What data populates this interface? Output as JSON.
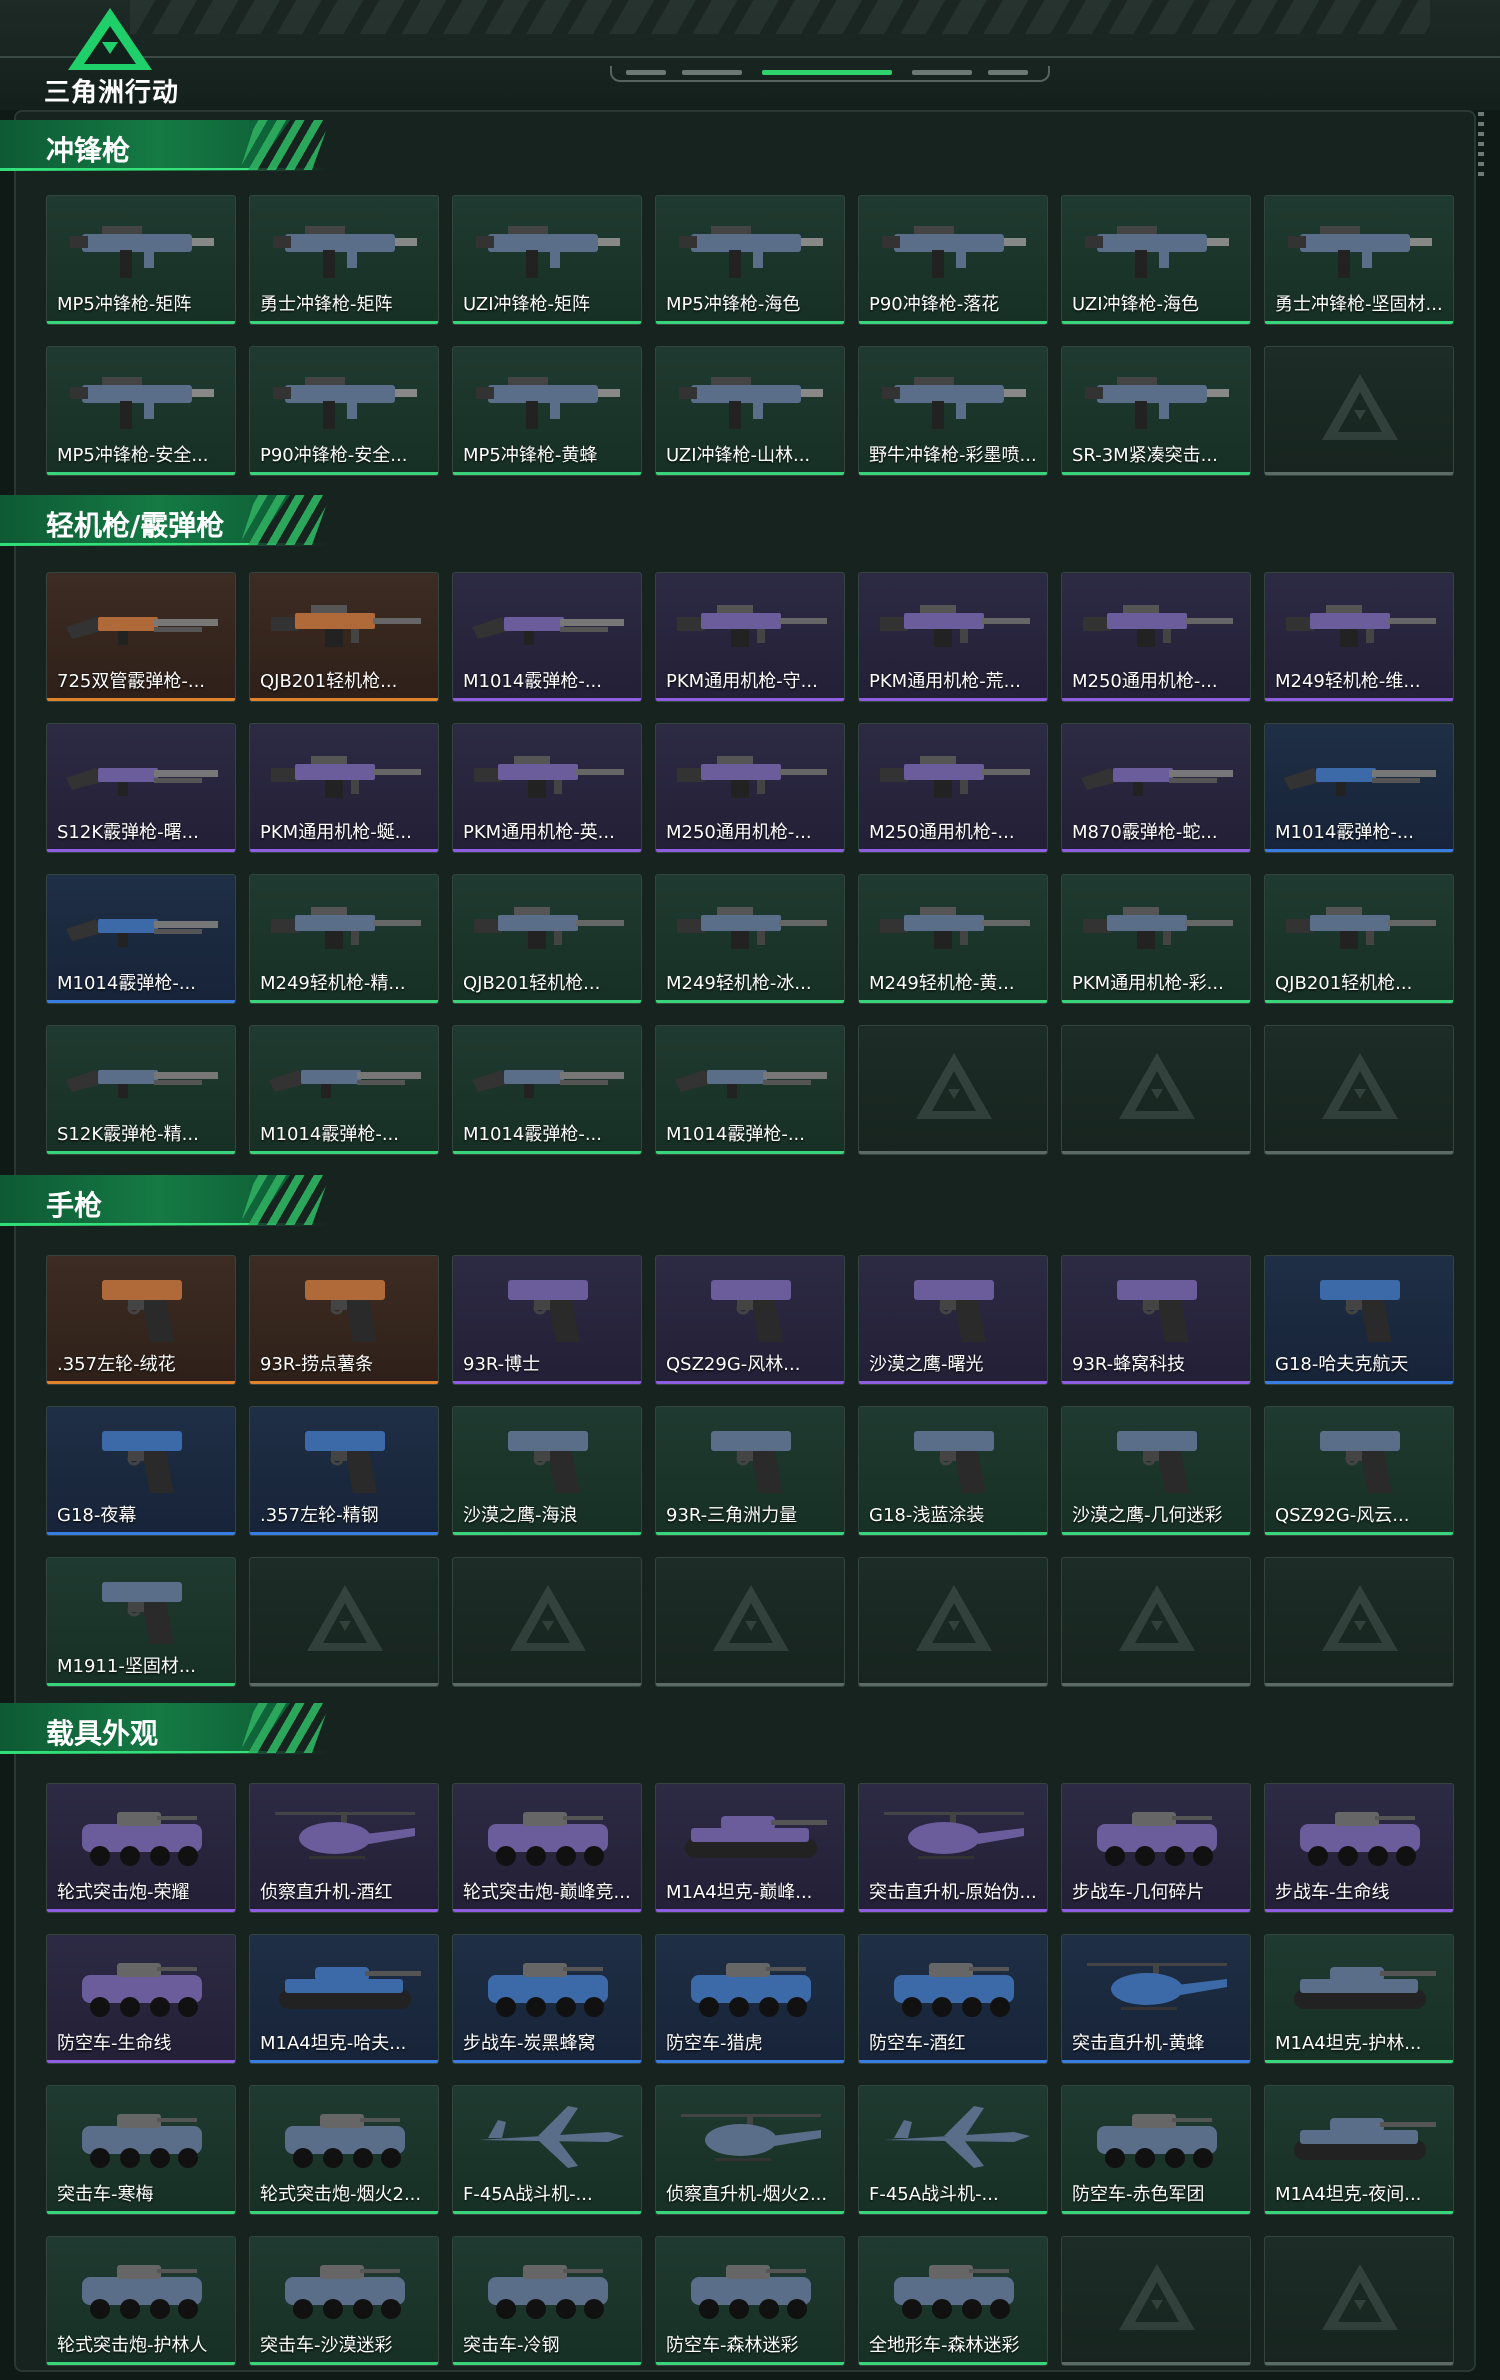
{
  "header": {
    "brand": "三角洲行动",
    "colors": {
      "accent": "#2fd36b",
      "panel": "#16231f"
    }
  },
  "sections": [
    {
      "title": "冲锋枪",
      "items": [
        {
          "label": "MP5冲锋枪-矩阵",
          "rarity": "green",
          "icon": "smg-icon"
        },
        {
          "label": "勇士冲锋枪-矩阵",
          "rarity": "green",
          "icon": "smg-icon"
        },
        {
          "label": "UZI冲锋枪-矩阵",
          "rarity": "green",
          "icon": "smg-icon"
        },
        {
          "label": "MP5冲锋枪-海色",
          "rarity": "green",
          "icon": "smg-icon"
        },
        {
          "label": "P90冲锋枪-落花",
          "rarity": "green",
          "icon": "smg-icon"
        },
        {
          "label": "UZI冲锋枪-海色",
          "rarity": "green",
          "icon": "smg-icon"
        },
        {
          "label": "勇士冲锋枪-坚固材...",
          "rarity": "green",
          "icon": "smg-icon"
        },
        {
          "label": "MP5冲锋枪-安全...",
          "rarity": "green",
          "icon": "smg-icon"
        },
        {
          "label": "P90冲锋枪-安全...",
          "rarity": "green",
          "icon": "smg-icon"
        },
        {
          "label": "MP5冲锋枪-黄蜂",
          "rarity": "green",
          "icon": "smg-icon"
        },
        {
          "label": "UZI冲锋枪-山林...",
          "rarity": "green",
          "icon": "smg-icon"
        },
        {
          "label": "野牛冲锋枪-彩墨喷...",
          "rarity": "green",
          "icon": "smg-icon"
        },
        {
          "label": "SR-3M紧凑突击...",
          "rarity": "green",
          "icon": "smg-icon"
        },
        {
          "label": "",
          "rarity": "empty",
          "icon": ""
        }
      ]
    },
    {
      "title": "轻机枪/霰弹枪",
      "items": [
        {
          "label": "725双管霰弹枪-...",
          "rarity": "orange",
          "icon": "shotgun-icon"
        },
        {
          "label": "QJB201轻机枪...",
          "rarity": "orange",
          "icon": "lmg-icon"
        },
        {
          "label": "M1014霰弹枪-...",
          "rarity": "purple",
          "icon": "shotgun-icon"
        },
        {
          "label": "PKM通用机枪-守...",
          "rarity": "purple",
          "icon": "lmg-icon"
        },
        {
          "label": "PKM通用机枪-荒...",
          "rarity": "purple",
          "icon": "lmg-icon"
        },
        {
          "label": "M250通用机枪-...",
          "rarity": "purple",
          "icon": "lmg-icon"
        },
        {
          "label": "M249轻机枪-维...",
          "rarity": "purple",
          "icon": "lmg-icon"
        },
        {
          "label": "S12K霰弹枪-曙...",
          "rarity": "purple",
          "icon": "shotgun-icon"
        },
        {
          "label": "PKM通用机枪-蜒...",
          "rarity": "purple",
          "icon": "lmg-icon"
        },
        {
          "label": "PKM通用机枪-英...",
          "rarity": "purple",
          "icon": "lmg-icon"
        },
        {
          "label": "M250通用机枪-...",
          "rarity": "purple",
          "icon": "lmg-icon"
        },
        {
          "label": "M250通用机枪-...",
          "rarity": "purple",
          "icon": "lmg-icon"
        },
        {
          "label": "M870霰弹枪-蛇...",
          "rarity": "purple",
          "icon": "shotgun-icon"
        },
        {
          "label": "M1014霰弹枪-...",
          "rarity": "blue",
          "icon": "shotgun-icon"
        },
        {
          "label": "M1014霰弹枪-...",
          "rarity": "blue",
          "icon": "shotgun-icon"
        },
        {
          "label": "M249轻机枪-精...",
          "rarity": "green",
          "icon": "lmg-icon"
        },
        {
          "label": "QJB201轻机枪...",
          "rarity": "green",
          "icon": "lmg-icon"
        },
        {
          "label": "M249轻机枪-冰...",
          "rarity": "green",
          "icon": "lmg-icon"
        },
        {
          "label": "M249轻机枪-黄...",
          "rarity": "green",
          "icon": "lmg-icon"
        },
        {
          "label": "PKM通用机枪-彩...",
          "rarity": "green",
          "icon": "lmg-icon"
        },
        {
          "label": "QJB201轻机枪...",
          "rarity": "green",
          "icon": "lmg-icon"
        },
        {
          "label": "S12K霰弹枪-精...",
          "rarity": "green",
          "icon": "shotgun-icon"
        },
        {
          "label": "M1014霰弹枪-...",
          "rarity": "green",
          "icon": "shotgun-icon"
        },
        {
          "label": "M1014霰弹枪-...",
          "rarity": "green",
          "icon": "shotgun-icon"
        },
        {
          "label": "M1014霰弹枪-...",
          "rarity": "green",
          "icon": "shotgun-icon"
        },
        {
          "label": "",
          "rarity": "empty",
          "icon": ""
        },
        {
          "label": "",
          "rarity": "empty",
          "icon": ""
        },
        {
          "label": "",
          "rarity": "empty",
          "icon": ""
        }
      ]
    },
    {
      "title": "手枪",
      "items": [
        {
          "label": ".357左轮-绒花",
          "rarity": "orange",
          "icon": "pistol-icon"
        },
        {
          "label": "93R-捞点薯条",
          "rarity": "orange",
          "icon": "pistol-icon"
        },
        {
          "label": "93R-博士",
          "rarity": "purple",
          "icon": "pistol-icon"
        },
        {
          "label": "QSZ29G-风林...",
          "rarity": "purple",
          "icon": "pistol-icon"
        },
        {
          "label": "沙漠之鹰-曙光",
          "rarity": "purple",
          "icon": "pistol-icon"
        },
        {
          "label": "93R-蜂窝科技",
          "rarity": "purple",
          "icon": "pistol-icon"
        },
        {
          "label": "G18-哈夫克航天",
          "rarity": "blue",
          "icon": "pistol-icon"
        },
        {
          "label": "G18-夜幕",
          "rarity": "blue",
          "icon": "pistol-icon"
        },
        {
          "label": ".357左轮-精钢",
          "rarity": "blue",
          "icon": "pistol-icon"
        },
        {
          "label": "沙漠之鹰-海浪",
          "rarity": "green",
          "icon": "pistol-icon"
        },
        {
          "label": "93R-三角洲力量",
          "rarity": "green",
          "icon": "pistol-icon"
        },
        {
          "label": "G18-浅蓝涂装",
          "rarity": "green",
          "icon": "pistol-icon"
        },
        {
          "label": "沙漠之鹰-几何迷彩",
          "rarity": "green",
          "icon": "pistol-icon"
        },
        {
          "label": "QSZ92G-风云...",
          "rarity": "green",
          "icon": "pistol-icon"
        },
        {
          "label": "M1911-坚固材...",
          "rarity": "green",
          "icon": "pistol-icon"
        },
        {
          "label": "",
          "rarity": "empty",
          "icon": ""
        },
        {
          "label": "",
          "rarity": "empty",
          "icon": ""
        },
        {
          "label": "",
          "rarity": "empty",
          "icon": ""
        },
        {
          "label": "",
          "rarity": "empty",
          "icon": ""
        },
        {
          "label": "",
          "rarity": "empty",
          "icon": ""
        },
        {
          "label": "",
          "rarity": "empty",
          "icon": ""
        }
      ]
    },
    {
      "title": "载具外观",
      "items": [
        {
          "label": "轮式突击炮-荣耀",
          "rarity": "purple",
          "icon": "vehicle-icon"
        },
        {
          "label": "侦察直升机-酒红",
          "rarity": "purple",
          "icon": "helicopter-icon"
        },
        {
          "label": "轮式突击炮-巅峰竞...",
          "rarity": "purple",
          "icon": "vehicle-icon"
        },
        {
          "label": "M1A4坦克-巅峰...",
          "rarity": "purple",
          "icon": "tank-icon"
        },
        {
          "label": "突击直升机-原始伪...",
          "rarity": "purple",
          "icon": "helicopter-icon"
        },
        {
          "label": "步战车-几何碎片",
          "rarity": "purple",
          "icon": "vehicle-icon"
        },
        {
          "label": "步战车-生命线",
          "rarity": "purple",
          "icon": "vehicle-icon"
        },
        {
          "label": "防空车-生命线",
          "rarity": "purple",
          "icon": "vehicle-icon"
        },
        {
          "label": "M1A4坦克-哈夫...",
          "rarity": "blue",
          "icon": "tank-icon"
        },
        {
          "label": "步战车-炭黑蜂窝",
          "rarity": "blue",
          "icon": "vehicle-icon"
        },
        {
          "label": "防空车-猎虎",
          "rarity": "blue",
          "icon": "vehicle-icon"
        },
        {
          "label": "防空车-酒红",
          "rarity": "blue",
          "icon": "vehicle-icon"
        },
        {
          "label": "突击直升机-黄蜂",
          "rarity": "blue",
          "icon": "helicopter-icon"
        },
        {
          "label": "M1A4坦克-护林...",
          "rarity": "green",
          "icon": "tank-icon"
        },
        {
          "label": "突击车-寒梅",
          "rarity": "green",
          "icon": "vehicle-icon"
        },
        {
          "label": "轮式突击炮-烟火2...",
          "rarity": "green",
          "icon": "vehicle-icon"
        },
        {
          "label": "F-45A战斗机-...",
          "rarity": "green",
          "icon": "jet-icon"
        },
        {
          "label": "侦察直升机-烟火2...",
          "rarity": "green",
          "icon": "helicopter-icon"
        },
        {
          "label": "F-45A战斗机-...",
          "rarity": "green",
          "icon": "jet-icon"
        },
        {
          "label": "防空车-赤色军团",
          "rarity": "green",
          "icon": "vehicle-icon"
        },
        {
          "label": "M1A4坦克-夜间...",
          "rarity": "green",
          "icon": "tank-icon"
        },
        {
          "label": "轮式突击炮-护林人",
          "rarity": "green",
          "icon": "vehicle-icon"
        },
        {
          "label": "突击车-沙漠迷彩",
          "rarity": "green",
          "icon": "vehicle-icon"
        },
        {
          "label": "突击车-冷钢",
          "rarity": "green",
          "icon": "vehicle-icon"
        },
        {
          "label": "防空车-森林迷彩",
          "rarity": "green",
          "icon": "vehicle-icon"
        },
        {
          "label": "全地形车-森林迷彩",
          "rarity": "green",
          "icon": "vehicle-icon"
        },
        {
          "label": "",
          "rarity": "empty",
          "icon": ""
        },
        {
          "label": "",
          "rarity": "empty",
          "icon": ""
        }
      ]
    }
  ]
}
